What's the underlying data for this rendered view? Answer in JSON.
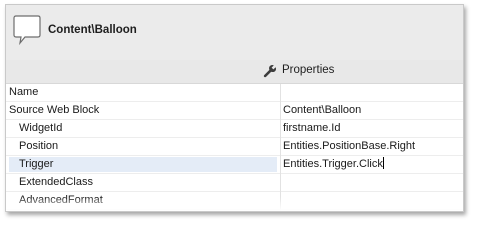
{
  "header": {
    "icon": "speech-balloon-icon",
    "title": "Content\\Balloon"
  },
  "properties_bar": {
    "icon": "wrench-icon",
    "label": "Properties"
  },
  "rows": [
    {
      "name": "Name",
      "value": ""
    },
    {
      "name": "Source Web Block",
      "value": "Content\\Balloon"
    },
    {
      "name": "WidgetId",
      "value": "firstname.Id"
    },
    {
      "name": "Position",
      "value": "Entities.PositionBase.Right"
    },
    {
      "name": "Trigger",
      "value": "Entities.Trigger.Click"
    },
    {
      "name": "ExtendedClass",
      "value": ""
    },
    {
      "name": "AdvancedFormat",
      "value": ""
    }
  ],
  "colors": {
    "header_bg": "#ebebeb",
    "selected_row_bg": "#e4ecf7"
  }
}
